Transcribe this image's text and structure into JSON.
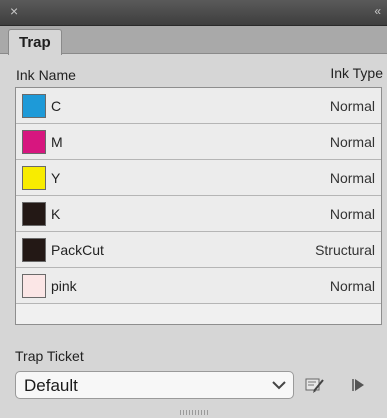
{
  "window": {
    "close_glyph": "×",
    "collapse_glyph": "«"
  },
  "tabs": [
    {
      "label": "Trap"
    }
  ],
  "columns": {
    "name": "Ink Name",
    "type": "Ink Type"
  },
  "inks": [
    {
      "name": "C",
      "type": "Normal",
      "color": "#1e9ad8"
    },
    {
      "name": "M",
      "type": "Normal",
      "color": "#d7167f"
    },
    {
      "name": "Y",
      "type": "Normal",
      "color": "#f8ec00"
    },
    {
      "name": "K",
      "type": "Normal",
      "color": "#231815"
    },
    {
      "name": "PackCut",
      "type": "Structural",
      "color": "#231815"
    },
    {
      "name": "pink",
      "type": "Normal",
      "color": "#fbe6e6"
    }
  ],
  "trap_ticket": {
    "label": "Trap Ticket",
    "selected": "Default"
  },
  "icons": {
    "close": "close-icon",
    "collapse": "collapse-panel-icon",
    "dropdown": "chevron-down-icon",
    "edit": "edit-ticket-icon",
    "apply": "play-icon"
  }
}
